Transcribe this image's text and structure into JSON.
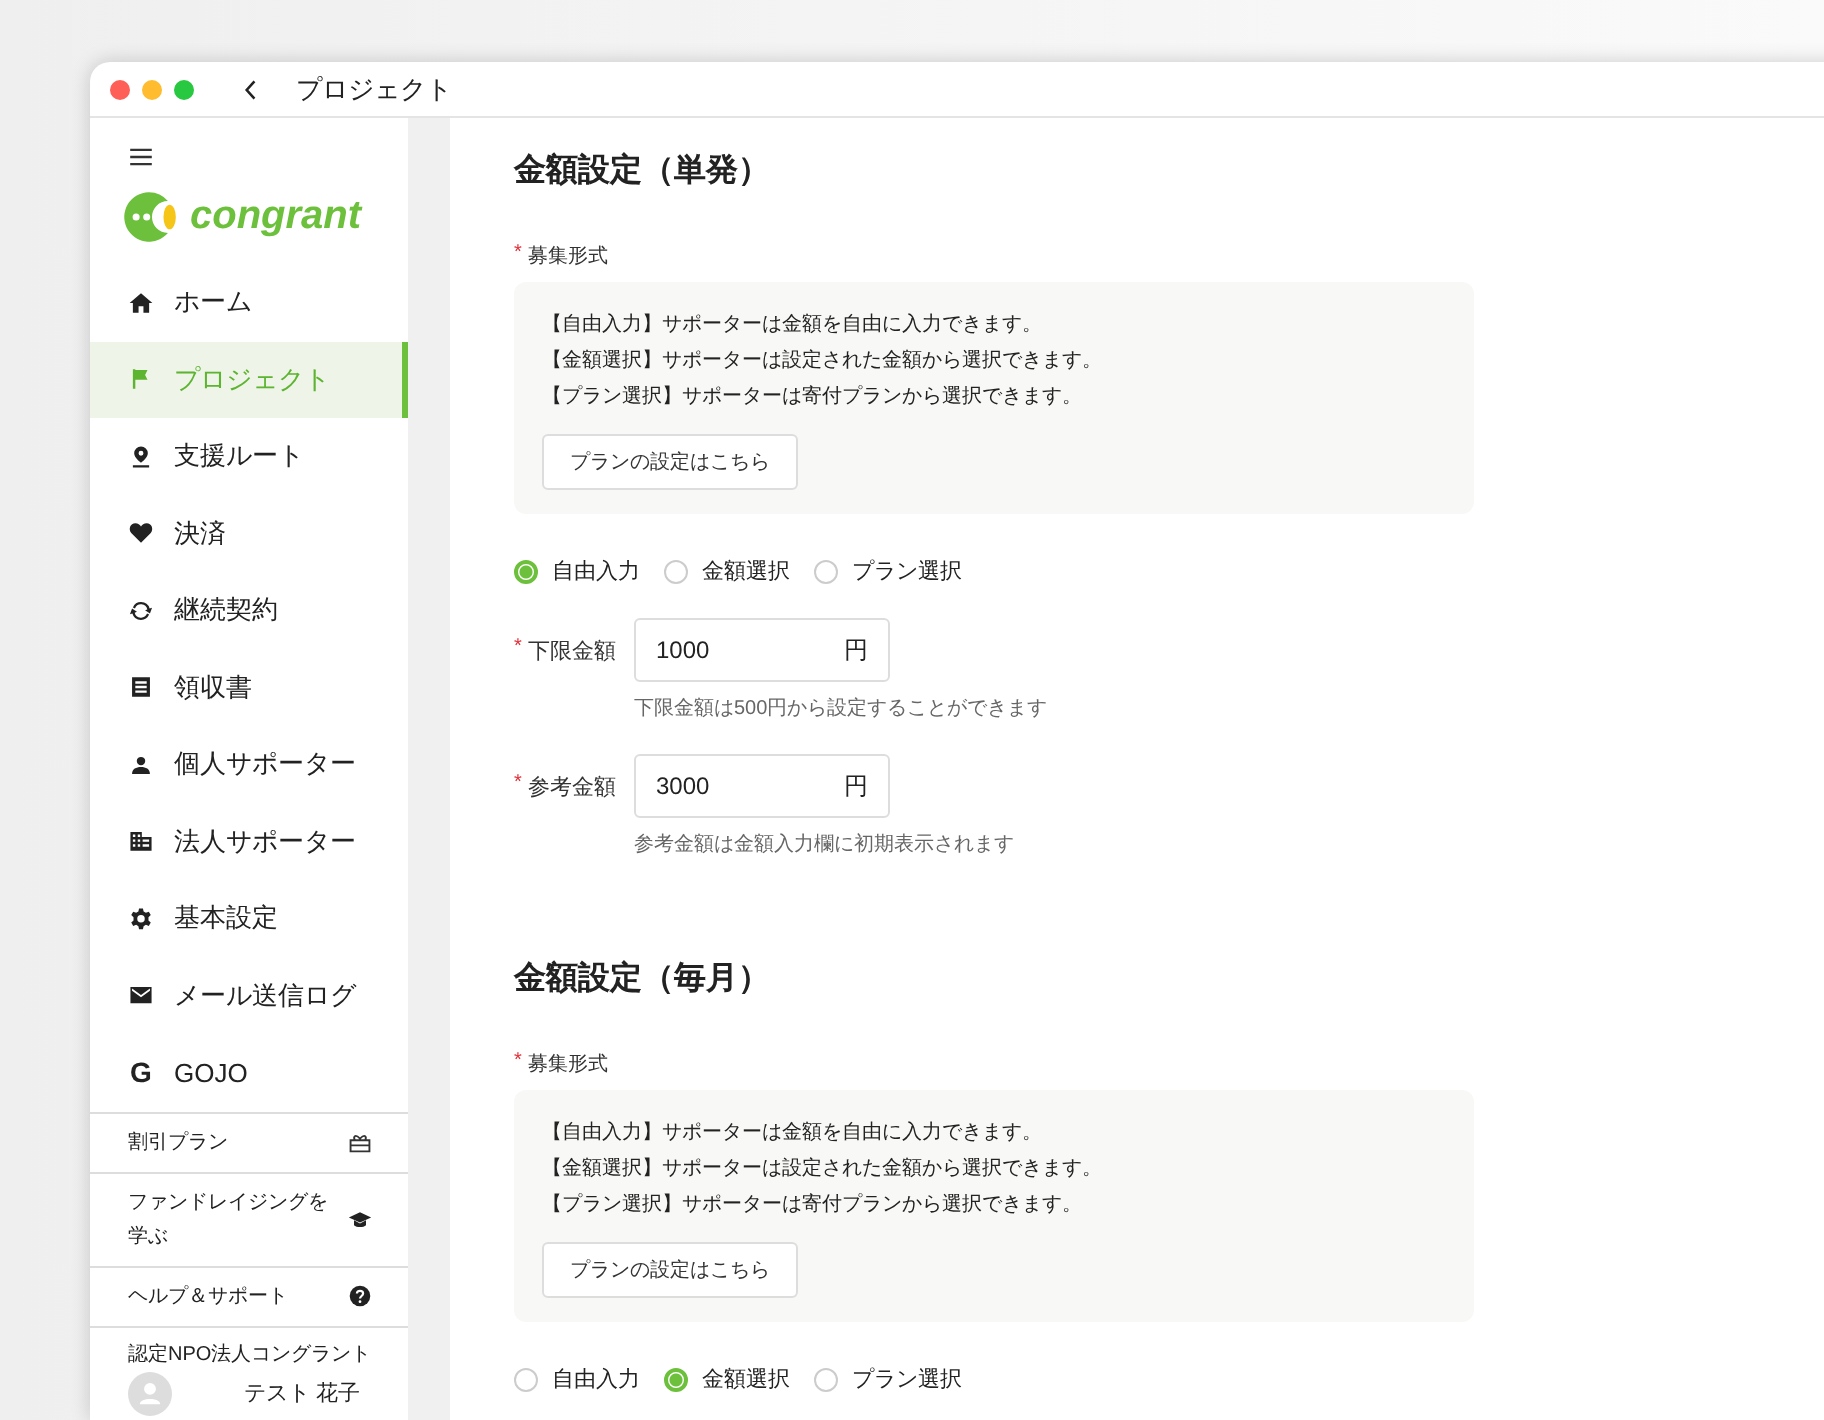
{
  "window": {
    "title": "プロジェクト"
  },
  "sidebar": {
    "logo_text": "congrant",
    "nav": [
      {
        "label": "ホーム",
        "selected": false
      },
      {
        "label": "プロジェクト",
        "selected": true
      },
      {
        "label": "支援ルート",
        "selected": false
      },
      {
        "label": "決済",
        "selected": false
      },
      {
        "label": "継続契約",
        "selected": false
      },
      {
        "label": "領収書",
        "selected": false
      },
      {
        "label": "個人サポーター",
        "selected": false
      },
      {
        "label": "法人サポーター",
        "selected": false
      },
      {
        "label": "基本設定",
        "selected": false
      },
      {
        "label": "メール送信ログ",
        "selected": false
      },
      {
        "label": "GOJO",
        "selected": false,
        "icon_text": "G"
      }
    ],
    "footer_links": [
      {
        "label": "割引プラン"
      },
      {
        "label": "ファンドレイジングを学ぶ"
      },
      {
        "label": "ヘルプ＆サポート"
      }
    ],
    "organization": "認定NPO法人コングラント",
    "user_name": "テスト 花子"
  },
  "sections": [
    {
      "title": "金額設定（単発）",
      "recruit_label": {
        "mark": "*",
        "text": "募集形式"
      },
      "info_lines": [
        "【自由入力】サポーターは金額を自由に入力できます。",
        "【金額選択】サポーターは設定された金額から選択できます。",
        "【プラン選択】サポーターは寄付プランから選択できます。"
      ],
      "plan_button": "プランの設定はこちら",
      "radios": [
        {
          "label": "自由入力",
          "selected": true
        },
        {
          "label": "金額選択",
          "selected": false
        },
        {
          "label": "プラン選択",
          "selected": false
        }
      ],
      "fields": [
        {
          "mark": "*",
          "label": "下限金額",
          "value": "1000",
          "unit": "円",
          "help": "下限金額は500円から設定することができます"
        },
        {
          "mark": "*",
          "label": "参考金額",
          "value": "3000",
          "unit": "円",
          "help": "参考金額は金額入力欄に初期表示されます"
        }
      ]
    },
    {
      "title": "金額設定（毎月）",
      "recruit_label": {
        "mark": "*",
        "text": "募集形式"
      },
      "info_lines": [
        "【自由入力】サポーターは金額を自由に入力できます。",
        "【金額選択】サポーターは設定された金額から選択できます。",
        "【プラン選択】サポーターは寄付プランから選択できます。"
      ],
      "plan_button": "プランの設定はこちら",
      "radios": [
        {
          "label": "自由入力",
          "selected": false
        },
        {
          "label": "金額選択",
          "selected": true
        },
        {
          "label": "プラン選択",
          "selected": false
        }
      ]
    }
  ]
}
